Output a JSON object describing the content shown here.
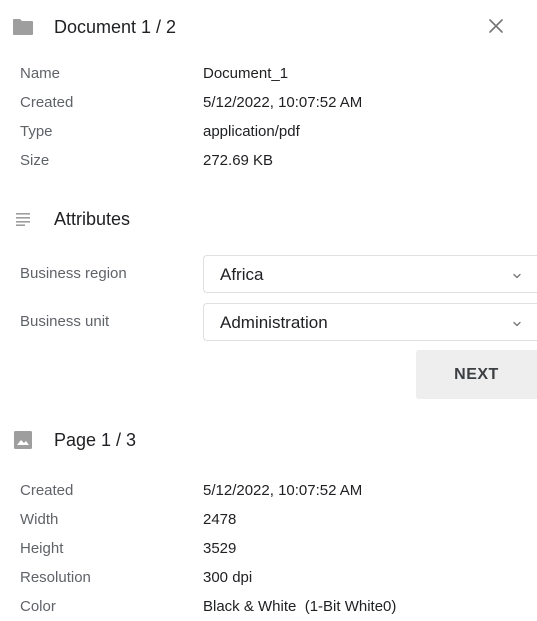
{
  "document": {
    "title": "Document 1 / 2",
    "props": [
      {
        "label": "Name",
        "value": "Document_1"
      },
      {
        "label": "Created",
        "value": "5/12/2022, 10:07:52 AM"
      },
      {
        "label": "Type",
        "value": "application/pdf"
      },
      {
        "label": "Size",
        "value": "272.69 KB"
      }
    ]
  },
  "attributes": {
    "title": "Attributes",
    "fields": [
      {
        "label": "Business region",
        "value": "Africa"
      },
      {
        "label": "Business unit",
        "value": "Administration"
      }
    ],
    "next_label": "NEXT"
  },
  "page": {
    "title": "Page 1 / 3",
    "props": [
      {
        "label": "Created",
        "value": "5/12/2022, 10:07:52 AM"
      },
      {
        "label": "Width",
        "value": "2478"
      },
      {
        "label": "Height",
        "value": "3529"
      },
      {
        "label": "Resolution",
        "value": "300 dpi"
      },
      {
        "label": "Color",
        "value": "Black & White  (1-Bit White0)"
      }
    ]
  },
  "icons": {
    "folder": "folder-icon",
    "close": "close-icon",
    "attributes": "list-lines-icon",
    "page": "image-icon",
    "dropdown": "chevron-down-icon"
  },
  "colors": {
    "icon_gray": "#9e9e9e",
    "label_gray": "#5f6368",
    "button_bg": "#eeeeee"
  }
}
